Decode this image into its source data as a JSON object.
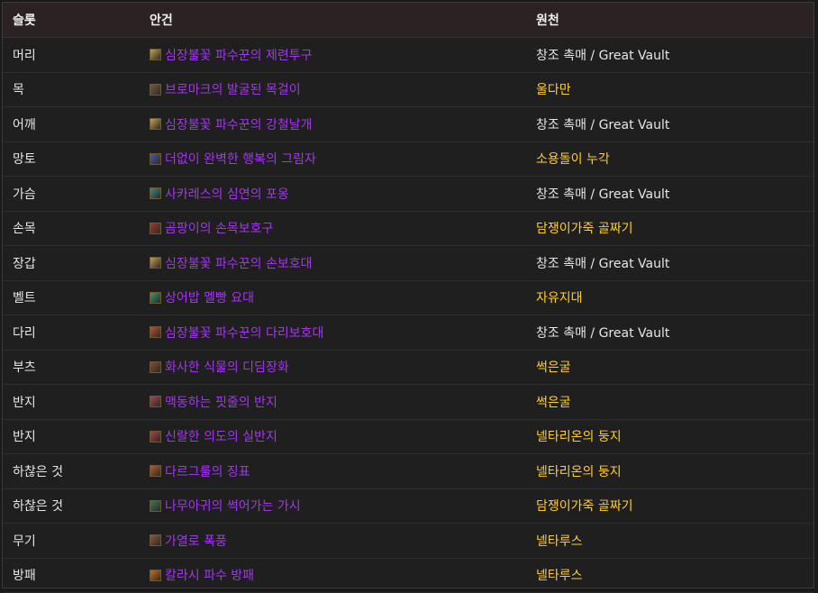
{
  "headers": {
    "slot": "슬롯",
    "item": "안건",
    "source": "원천"
  },
  "colors": {
    "item_epic": "#a335ee",
    "source_gold": "#ffcc33",
    "source_white": "#e6e6e6"
  },
  "rows": [
    {
      "slot": "머리",
      "item": "심장불꽃 파수꾼의 제련투구",
      "icon": "helm-icon",
      "icon_color": "#c9a04a",
      "source": "창조 촉매 / Great Vault",
      "source_style": "white"
    },
    {
      "slot": "목",
      "item": "브로마크의 발굴된 목걸이",
      "icon": "necklace-icon",
      "icon_color": "#7a5a3a",
      "source": "울다만",
      "source_style": "gold"
    },
    {
      "slot": "어깨",
      "item": "심장불꽃 파수꾼의 강철날개",
      "icon": "shoulder-icon",
      "icon_color": "#c9a04a",
      "source": "창조 촉매 / Great Vault",
      "source_style": "white"
    },
    {
      "slot": "망토",
      "item": "더없이 완벽한 행복의 그림자",
      "icon": "cloak-icon",
      "icon_color": "#4a5aa0",
      "source": "소용돌이 누각",
      "source_style": "gold"
    },
    {
      "slot": "가슴",
      "item": "사카레스의 심연의 포옹",
      "icon": "chest-icon",
      "icon_color": "#3a8a8a",
      "source": "창조 촉매 / Great Vault",
      "source_style": "white"
    },
    {
      "slot": "손목",
      "item": "곰팡이의 손목보호구",
      "icon": "bracer-icon",
      "icon_color": "#a03a2a",
      "source": "담쟁이가죽 골짜기",
      "source_style": "gold"
    },
    {
      "slot": "장갑",
      "item": "심장불꽃 파수꾼의 손보호대",
      "icon": "gloves-icon",
      "icon_color": "#c9a04a",
      "source": "창조 촉매 / Great Vault",
      "source_style": "white"
    },
    {
      "slot": "벨트",
      "item": "상어밥 멜빵 요대",
      "icon": "belt-icon",
      "icon_color": "#3a9a6a",
      "source": "자유지대",
      "source_style": "gold"
    },
    {
      "slot": "다리",
      "item": "심장불꽃 파수꾼의 다리보호대",
      "icon": "legs-icon",
      "icon_color": "#c0502a",
      "source": "창조 촉매 / Great Vault",
      "source_style": "white"
    },
    {
      "slot": "부츠",
      "item": "화사한 식물의 디딤장화",
      "icon": "boots-icon",
      "icon_color": "#8a4a2a",
      "source": "썩은굴",
      "source_style": "gold"
    },
    {
      "slot": "반지",
      "item": "맥동하는 핏줄의 반지",
      "icon": "ring-icon",
      "icon_color": "#a04a4a",
      "source": "썩은굴",
      "source_style": "gold"
    },
    {
      "slot": "반지",
      "item": "신랄한 의도의 실반지",
      "icon": "ring-icon",
      "icon_color": "#b04040",
      "source": "넬타리온의 둥지",
      "source_style": "gold"
    },
    {
      "slot": "하찮은 것",
      "item": "다르그룰의 징표",
      "icon": "trinket-icon",
      "icon_color": "#c05a2a",
      "source": "넬타리온의 둥지",
      "source_style": "gold"
    },
    {
      "slot": "하찮은 것",
      "item": "나무아귀의 썩어가는 가시",
      "icon": "trinket-icon",
      "icon_color": "#3a7a4a",
      "source": "담쟁이가죽 골짜기",
      "source_style": "gold"
    },
    {
      "slot": "무기",
      "item": "가열로 폭풍",
      "icon": "weapon-icon",
      "icon_color": "#8a5a3a",
      "source": "넬타루스",
      "source_style": "gold"
    },
    {
      "slot": "방패",
      "item": "칼라시 파수 방패",
      "icon": "shield-icon",
      "icon_color": "#d06a1a",
      "source": "넬타루스",
      "source_style": "gold"
    }
  ]
}
